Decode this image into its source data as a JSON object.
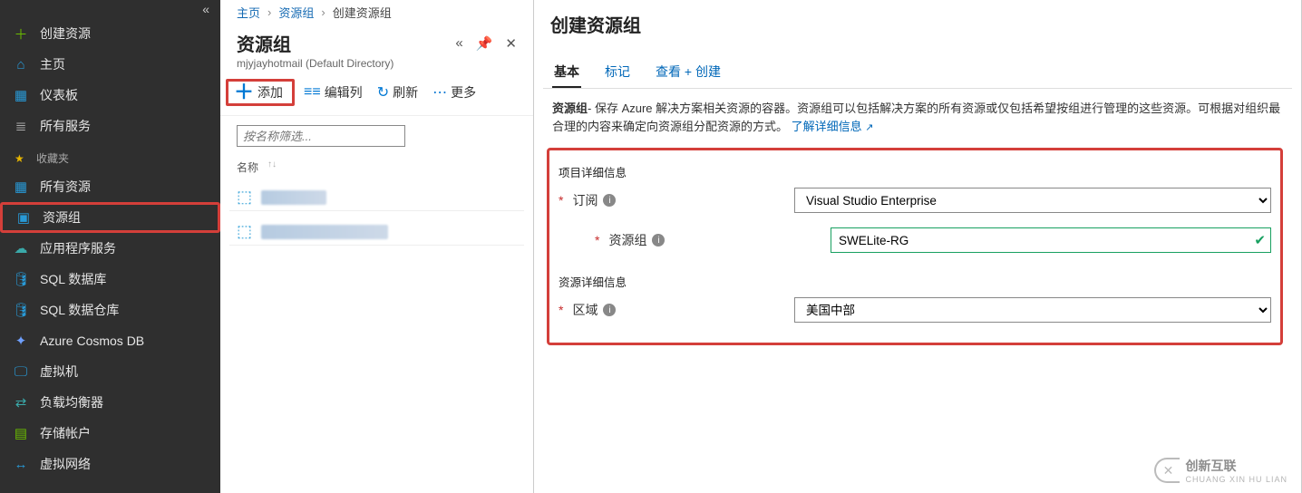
{
  "sidebar": {
    "items": [
      {
        "label": "创建资源",
        "icon": "＋",
        "iconClass": "icon-green"
      },
      {
        "label": "主页",
        "icon": "⌂",
        "iconClass": "icon-blue"
      },
      {
        "label": "仪表板",
        "icon": "▦",
        "iconClass": "icon-blue"
      },
      {
        "label": "所有服务",
        "icon": "≣",
        "iconClass": "icon-gray"
      }
    ],
    "favLabel": "收藏夹",
    "favs": [
      {
        "label": "所有资源",
        "icon": "▦",
        "iconClass": "icon-blue",
        "highlight": false
      },
      {
        "label": "资源组",
        "icon": "▣",
        "iconClass": "icon-blue",
        "highlight": true
      },
      {
        "label": "应用程序服务",
        "icon": "☁",
        "iconClass": "icon-teal",
        "highlight": false
      },
      {
        "label": "SQL 数据库",
        "icon": "🛢",
        "iconClass": "icon-blue",
        "highlight": false
      },
      {
        "label": "SQL 数据仓库",
        "icon": "🛢",
        "iconClass": "icon-blue",
        "highlight": false
      },
      {
        "label": "Azure Cosmos DB",
        "icon": "✦",
        "iconClass": "icon-cosmos",
        "highlight": false
      },
      {
        "label": "虚拟机",
        "icon": "🖵",
        "iconClass": "icon-blue",
        "highlight": false
      },
      {
        "label": "负载均衡器",
        "icon": "⇄",
        "iconClass": "icon-teal",
        "highlight": false
      },
      {
        "label": "存储帐户",
        "icon": "▤",
        "iconClass": "icon-green",
        "highlight": false
      },
      {
        "label": "虚拟网络",
        "icon": "↔",
        "iconClass": "icon-blue",
        "highlight": false
      }
    ]
  },
  "breadcrumb": {
    "home": "主页",
    "rg": "资源组",
    "create": "创建资源组"
  },
  "mid": {
    "title": "资源组",
    "subtitle": "mjyjayhotmail (Default Directory)",
    "toolbar": {
      "add": "添加",
      "editCols": "编辑列",
      "refresh": "刷新",
      "more": "更多"
    },
    "filterPlaceholder": "按名称筛选...",
    "nameHeader": "名称"
  },
  "right": {
    "title": "创建资源组",
    "tabs": {
      "basic": "基本",
      "tags": "标记",
      "review": "查看 + 创建"
    },
    "descLead": "资源组",
    "descBody": "- 保存 Azure 解决方案相关资源的容器。资源组可以包括解决方案的所有资源或仅包括希望按组进行管理的这些资源。可根据对组织最合理的内容来确定向资源组分配资源的方式。",
    "learnMore": "了解详细信息",
    "form": {
      "projectSection": "项目详细信息",
      "subscriptionLabel": "订阅",
      "subscriptionValue": "Visual Studio Enterprise",
      "rgLabel": "资源组",
      "rgValue": "SWELite-RG",
      "resourceSection": "资源详细信息",
      "regionLabel": "区域",
      "regionValue": "美国中部"
    }
  },
  "watermark": {
    "big": "创新互联",
    "small": "CHUANG XIN HU LIAN"
  }
}
